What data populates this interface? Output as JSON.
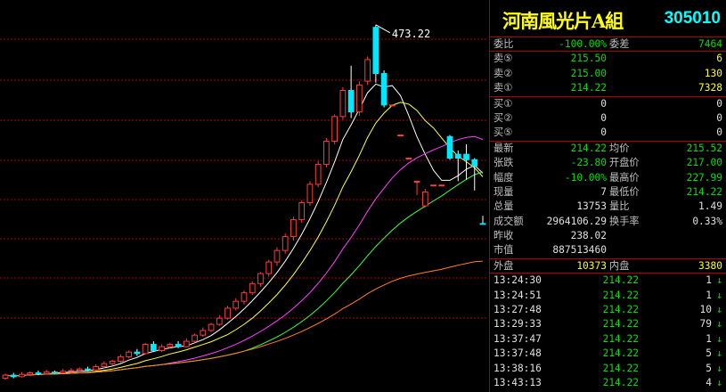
{
  "security": {
    "name": "河南風光片A組",
    "code": "305010"
  },
  "chart": {
    "high_label": "473.22",
    "colors": {
      "up": "#ff3c3c",
      "down": "#00e8ff",
      "ma5": "#ffffff",
      "ma10": "#ffff40",
      "ma20": "#ff40ff",
      "ma30": "#40ff40",
      "ma60": "#ff8020",
      "grid": "#b00000"
    }
  },
  "chart_data": {
    "type": "candlestick",
    "candles": [
      {
        "o": 14,
        "c": 18,
        "h": 20,
        "l": 12
      },
      {
        "o": 18,
        "c": 16,
        "h": 21,
        "l": 14
      },
      {
        "o": 16,
        "c": 19,
        "h": 22,
        "l": 15
      },
      {
        "o": 19,
        "c": 21,
        "h": 23,
        "l": 17
      },
      {
        "o": 21,
        "c": 20,
        "h": 24,
        "l": 18
      },
      {
        "o": 20,
        "c": 22,
        "h": 25,
        "l": 19
      },
      {
        "o": 22,
        "c": 21,
        "h": 24,
        "l": 20
      },
      {
        "o": 21,
        "c": 23,
        "h": 26,
        "l": 20
      },
      {
        "o": 23,
        "c": 24,
        "h": 27,
        "l": 21
      },
      {
        "o": 24,
        "c": 26,
        "h": 28,
        "l": 22
      },
      {
        "o": 26,
        "c": 25,
        "h": 29,
        "l": 23
      },
      {
        "o": 25,
        "c": 29,
        "h": 32,
        "l": 24
      },
      {
        "o": 29,
        "c": 33,
        "h": 36,
        "l": 27
      },
      {
        "o": 33,
        "c": 36,
        "h": 38,
        "l": 31
      },
      {
        "o": 36,
        "c": 42,
        "h": 45,
        "l": 34
      },
      {
        "o": 42,
        "c": 48,
        "h": 50,
        "l": 40
      },
      {
        "o": 48,
        "c": 46,
        "h": 52,
        "l": 43
      },
      {
        "o": 46,
        "c": 58,
        "h": 60,
        "l": 45
      },
      {
        "o": 58,
        "c": 50,
        "h": 62,
        "l": 48
      },
      {
        "o": 50,
        "c": 55,
        "h": 58,
        "l": 48
      },
      {
        "o": 55,
        "c": 58,
        "h": 60,
        "l": 53
      },
      {
        "o": 58,
        "c": 55,
        "h": 62,
        "l": 53
      },
      {
        "o": 55,
        "c": 62,
        "h": 66,
        "l": 54
      },
      {
        "o": 62,
        "c": 70,
        "h": 72,
        "l": 60
      },
      {
        "o": 70,
        "c": 76,
        "h": 80,
        "l": 68
      },
      {
        "o": 76,
        "c": 84,
        "h": 86,
        "l": 74
      },
      {
        "o": 84,
        "c": 92,
        "h": 96,
        "l": 82
      },
      {
        "o": 92,
        "c": 105,
        "h": 108,
        "l": 90
      },
      {
        "o": 105,
        "c": 114,
        "h": 118,
        "l": 102
      },
      {
        "o": 114,
        "c": 125,
        "h": 128,
        "l": 110
      },
      {
        "o": 125,
        "c": 137,
        "h": 140,
        "l": 122
      },
      {
        "o": 137,
        "c": 150,
        "h": 152,
        "l": 133
      },
      {
        "o": 150,
        "c": 165,
        "h": 168,
        "l": 146
      },
      {
        "o": 165,
        "c": 180,
        "h": 184,
        "l": 160
      },
      {
        "o": 180,
        "c": 198,
        "h": 202,
        "l": 176
      },
      {
        "o": 198,
        "c": 220,
        "h": 224,
        "l": 193
      },
      {
        "o": 220,
        "c": 242,
        "h": 245,
        "l": 216
      },
      {
        "o": 242,
        "c": 266,
        "h": 270,
        "l": 238
      },
      {
        "o": 266,
        "c": 292,
        "h": 296,
        "l": 262
      },
      {
        "o": 292,
        "c": 322,
        "h": 326,
        "l": 288
      },
      {
        "o": 322,
        "c": 354,
        "h": 357,
        "l": 318
      },
      {
        "o": 354,
        "c": 388,
        "h": 392,
        "l": 350
      },
      {
        "o": 388,
        "c": 360,
        "h": 420,
        "l": 352
      },
      {
        "o": 360,
        "c": 395,
        "h": 400,
        "l": 355
      },
      {
        "o": 400,
        "c": 428,
        "h": 432,
        "l": 395
      },
      {
        "o": 470,
        "c": 410,
        "h": 473.22,
        "l": 398
      },
      {
        "o": 410,
        "c": 369,
        "h": 414,
        "l": 366
      },
      {
        "o": 369,
        "c": 369,
        "h": 369,
        "l": 369
      },
      {
        "o": 330,
        "c": 330,
        "h": 330,
        "l": 330
      },
      {
        "o": 300,
        "c": 300,
        "h": 300,
        "l": 300
      },
      {
        "o": 270,
        "c": 270,
        "h": 270,
        "l": 252
      },
      {
        "o": 238,
        "c": 256,
        "h": 260,
        "l": 236
      },
      {
        "o": 265,
        "c": 265,
        "h": 265,
        "l": 265
      },
      {
        "o": 265,
        "c": 265,
        "h": 265,
        "l": 265
      },
      {
        "o": 328,
        "c": 300,
        "h": 330,
        "l": 298
      },
      {
        "o": 305,
        "c": 300,
        "h": 310,
        "l": 270
      },
      {
        "o": 305,
        "c": 298,
        "h": 318,
        "l": 272
      },
      {
        "o": 298,
        "c": 290,
        "h": 300,
        "l": 258
      },
      {
        "o": 215,
        "c": 214.22,
        "h": 225,
        "l": 214
      }
    ],
    "ylim": [
      10,
      480
    ]
  },
  "panel": {
    "weibi": {
      "label": "委比",
      "value": "-100.00%",
      "label2": "委差",
      "value2": "7464"
    },
    "sells": [
      {
        "label": "卖⑤",
        "price": "215.50",
        "vol": "6"
      },
      {
        "label": "卖②",
        "price": "215.00",
        "vol": "130"
      },
      {
        "label": "卖①",
        "price": "214.22",
        "vol": "7328"
      }
    ],
    "buys": [
      {
        "label": "买①",
        "price": "0",
        "vol": "0"
      },
      {
        "label": "买②",
        "price": "0",
        "vol": "0"
      },
      {
        "label": "买⑤",
        "price": "0",
        "vol": "0"
      }
    ],
    "stats": [
      {
        "l1": "最新",
        "v1": "214.22",
        "c1": "green",
        "l2": "均价",
        "v2": "215.52",
        "c2": "green"
      },
      {
        "l1": "张跌",
        "v1": "-23.80",
        "c1": "green",
        "l2": "开盘价",
        "v2": "217.00",
        "c2": "green"
      },
      {
        "l1": "幅度",
        "v1": "-10.00%",
        "c1": "green",
        "l2": "最高价",
        "v2": "227.99",
        "c2": "green"
      },
      {
        "l1": "现量",
        "v1": "7",
        "c1": "white",
        "l2": "最低价",
        "v2": "214.22",
        "c2": "green"
      },
      {
        "l1": "总量",
        "v1": "13753",
        "c1": "white",
        "l2": "量比",
        "v2": "1.49",
        "c2": "white"
      },
      {
        "l1": "成交额",
        "v1": "2964106.29",
        "c1": "white",
        "l2": "换手率",
        "v2": "0.33%",
        "c2": "white"
      },
      {
        "l1": "昨收",
        "v1": "238.02",
        "c1": "white",
        "l2": "",
        "v2": "",
        "c2": "white"
      },
      {
        "l1": "市值",
        "v1": "887513460",
        "c1": "white",
        "l2": "",
        "v2": "",
        "c2": "white"
      }
    ],
    "waipan": {
      "label": "外盘",
      "value": "10373",
      "label2": "内盘",
      "value2": "3380"
    },
    "ticks": [
      {
        "time": "13:24:30",
        "price": "214.22",
        "vol": "1",
        "dir": "↓"
      },
      {
        "time": "13:24:51",
        "price": "214.22",
        "vol": "1",
        "dir": "↓"
      },
      {
        "time": "13:27:48",
        "price": "214.22",
        "vol": "10",
        "dir": "↓"
      },
      {
        "time": "13:29:33",
        "price": "214.22",
        "vol": "79",
        "dir": "↓"
      },
      {
        "time": "13:37:47",
        "price": "214.22",
        "vol": "1",
        "dir": "↓"
      },
      {
        "time": "13:37:48",
        "price": "214.22",
        "vol": "5",
        "dir": "↓"
      },
      {
        "time": "13:38:16",
        "price": "214.22",
        "vol": "5",
        "dir": "↓"
      },
      {
        "time": "13:43:13",
        "price": "214.22",
        "vol": "4",
        "dir": "↓"
      }
    ]
  }
}
